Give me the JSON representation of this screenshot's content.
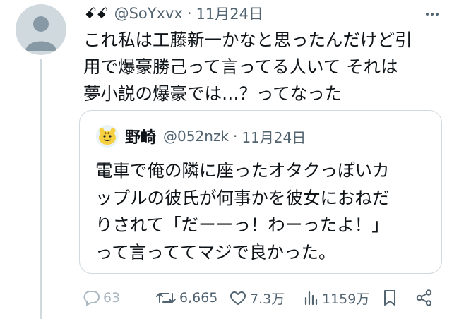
{
  "tweet": {
    "display_name": "ꗃꗃ",
    "handle": "@SoYxvx",
    "separator": "·",
    "date": "11月24日",
    "more_label": "•••",
    "text": "これ私は工藤新一かなと思ったんだけど引\n用で爆豪勝己って言ってる人いて それは\n夢小説の爆豪では…？ってなった"
  },
  "quote": {
    "display_name": "野崎",
    "handle": "@052nzk",
    "separator": "·",
    "date": "11月24日",
    "text": "電車で俺の隣に座ったオタクっぽいカ\nップルの彼氏が何事かを彼女におねだ\nりされて「だーーっ！わーったよ！」\nって言っててマジで良かった。"
  },
  "actions": {
    "replies": "63",
    "retweets": "6,665",
    "likes": "7.3万",
    "views": "1159万"
  },
  "colors": {
    "text": "#0f1419",
    "muted": "#536471",
    "border": "#cfd9de",
    "avatar_bg": "#cfd9de",
    "quote_avatar": "#f5d142"
  },
  "icons": [
    "default-avatar-icon",
    "more-icon",
    "reply-icon",
    "retweet-icon",
    "like-icon",
    "views-icon",
    "bookmark-icon",
    "share-icon"
  ]
}
